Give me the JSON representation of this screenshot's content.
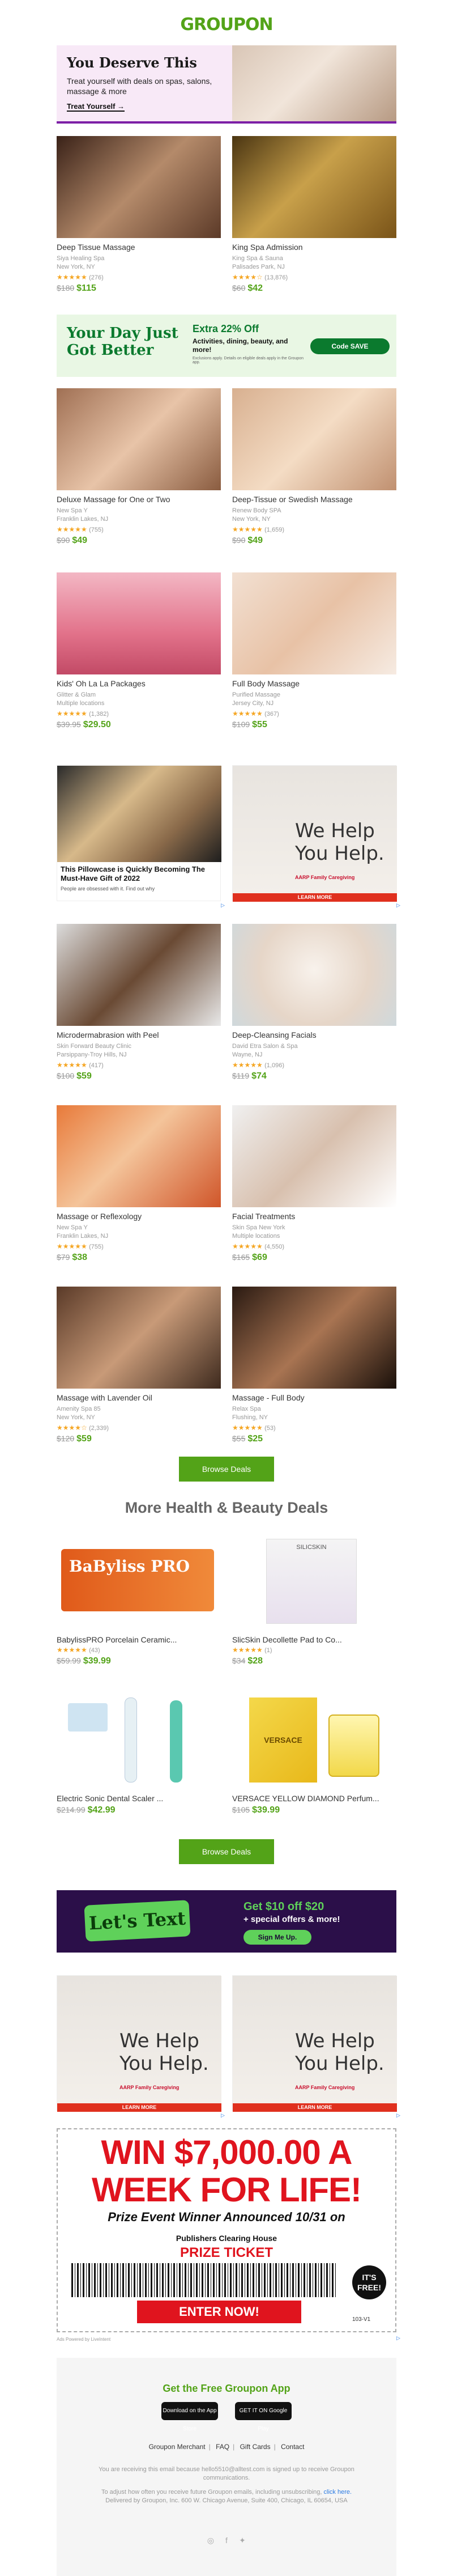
{
  "header": {
    "logo": "GROUPON"
  },
  "hero": {
    "title": "You Deserve This",
    "subtitle": "Treat yourself with deals on spas, salons, massage & more",
    "cta": "Treat Yourself →"
  },
  "deals_row1": [
    {
      "title": "Deep Tissue Massage",
      "merchant": "Siya Healing Spa",
      "location": "New York, NY",
      "stars": "★★★★★",
      "count": "(276)",
      "old": "$180",
      "new": "$115"
    },
    {
      "title": "King Spa Admission",
      "merchant": "King Spa & Sauna",
      "location": "Palisades Park, NJ",
      "stars": "★★★★☆",
      "count": "(13,876)",
      "old": "$60",
      "new": "$42"
    }
  ],
  "promo": {
    "left": "Your Day Just Got Better",
    "big": "Extra 22% Off",
    "small": "Activities, dining, beauty, and more!",
    "fine": "Exclusions apply. Details on eligible deals apply in the Groupon app.",
    "button": "Code SAVE"
  },
  "deals_row2": [
    {
      "title": "Deluxe Massage for One or Two",
      "merchant": "New Spa Y",
      "location": "Franklin Lakes, NJ",
      "stars": "★★★★★",
      "count": "(755)",
      "old": "$90",
      "new": "$49"
    },
    {
      "title": "Deep-Tissue or Swedish Massage",
      "merchant": "Renew Body SPA",
      "location": "New York, NY",
      "stars": "★★★★★",
      "count": "(1,659)",
      "old": "$90",
      "new": "$49"
    }
  ],
  "deals_row3": [
    {
      "title": "Kids' Oh La La Packages",
      "merchant": "Glitter & Glam",
      "location": "Multiple locations",
      "stars": "★★★★★",
      "count": "(1,382)",
      "old": "$39.95",
      "new": "$29.50"
    },
    {
      "title": "Full Body Massage",
      "merchant": "Purified Massage",
      "location": "Jersey City, NJ",
      "stars": "★★★★★",
      "count": "(367)",
      "old": "$109",
      "new": "$55"
    }
  ],
  "ads_row1": {
    "pillow_text": "This Pillowcase is Quickly Becoming The Must-Have Gift of 2022",
    "pillow_sub": "People are obsessed with it. Find out why",
    "help_text": "We Help You Help.",
    "help_brand": "AARP Family Caregiving",
    "help_bar": "LEARN MORE"
  },
  "deals_row4": [
    {
      "title": "Microdermabrasion with Peel",
      "merchant": "Skin Forward Beauty Clinic",
      "location": "Parsippany-Troy Hills, NJ",
      "stars": "★★★★★",
      "count": "(417)",
      "old": "$100",
      "new": "$59"
    },
    {
      "title": "Deep-Cleansing Facials",
      "merchant": "David Etra Salon & Spa",
      "location": "Wayne, NJ",
      "stars": "★★★★★",
      "count": "(1,096)",
      "old": "$119",
      "new": "$74"
    }
  ],
  "deals_row5": [
    {
      "title": "Massage or Reflexology",
      "merchant": "New Spa Y",
      "location": "Franklin Lakes, NJ",
      "stars": "★★★★★",
      "count": "(755)",
      "old": "$79",
      "new": "$38"
    },
    {
      "title": "Facial Treatments",
      "merchant": "Skin Spa New York",
      "location": "Multiple locations",
      "stars": "★★★★★",
      "count": "(4,550)",
      "old": "$165",
      "new": "$69"
    }
  ],
  "deals_row6": [
    {
      "title": "Massage with Lavender Oil",
      "merchant": "Amenity Spa 85",
      "location": "New York, NY",
      "stars": "★★★★☆",
      "count": "(2,339)",
      "old": "$120",
      "new": "$59"
    },
    {
      "title": "Massage - Full Body",
      "merchant": "Relax Spa",
      "location": "Flushing, NY",
      "stars": "★★★★★",
      "count": "(53)",
      "old": "$55",
      "new": "$25"
    }
  ],
  "browse_button": "Browse Deals",
  "section_title": "More Health & Beauty Deals",
  "products_row1": [
    {
      "title": "BabylissPRO Porcelain Ceramic...",
      "stars": "★★★★★",
      "count": "(43)",
      "old": "$59.99",
      "new": "$39.99",
      "brand_text": "BaByliss PRO"
    },
    {
      "title": "SlicSkin Decollette Pad to Co...",
      "stars": "★★★★★",
      "count": "(1)",
      "old": "$34",
      "new": "$28",
      "brand_text": "SILICSKIN"
    }
  ],
  "products_row2": [
    {
      "title": "Electric Sonic Dental Scaler ...",
      "old": "$214.99",
      "new": "$42.99"
    },
    {
      "title": "VERSACE YELLOW DIAMOND Perfum...",
      "old": "$105",
      "new": "$39.99",
      "brand_text": "VERSACE"
    }
  ],
  "browse_button_2": "Browse Deals",
  "letstext": {
    "left": "Let's Text",
    "big": "Get $10 off $20",
    "small": "+ special offers & more!",
    "button": "Sign Me Up."
  },
  "ads_row2": {
    "help_text": "We Help You Help.",
    "help_brand": "AARP Family Caregiving",
    "help_bar": "LEARN MORE"
  },
  "pch": {
    "win": "WIN $7,000.00 A WEEK FOR LIFE!",
    "sub": "Prize Event Winner Announced 10/31 on",
    "logo": "Publishers Clearing House",
    "ticket": "PRIZE TICKET",
    "free": "IT'S FREE!",
    "enter": "ENTER NOW!",
    "code": "103-V1"
  },
  "powered": "Ads  Powered by LiveIntent",
  "footer": {
    "app_title": "Get the Free Groupon App",
    "app_store": "Download on the App Store",
    "play_store": "GET IT ON Google Play",
    "links": [
      "Groupon Merchant",
      "FAQ",
      "Gift Cards",
      "Contact"
    ],
    "receiving": "You are receiving this email because hello5510@alltest.com is signed up to receive Groupon communications.",
    "adjust_prefix": "To adjust how often you receive future Groupon emails, including unsubscribing,",
    "adjust_link": "click here.",
    "address": "Delivered by Groupon, Inc. 600 W. Chicago Avenue, Suite 400, Chicago, IL 60654, USA",
    "social": [
      "instagram-icon",
      "facebook-icon",
      "twitter-icon"
    ]
  },
  "colors": {
    "brand": "#53a318",
    "hero_bg": "#f8e9f7",
    "promo_bg": "#e9f7e4",
    "letstext_bg": "#2b0f49",
    "pch_red": "#e0141e"
  }
}
